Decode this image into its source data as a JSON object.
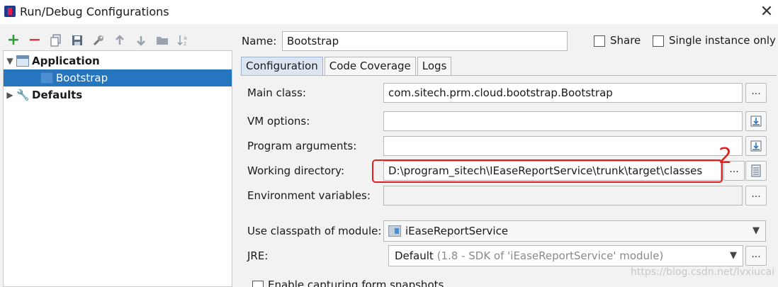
{
  "window": {
    "title": "Run/Debug Configurations",
    "close_glyph": "✕"
  },
  "toolbar": {
    "buttons": [
      {
        "name": "add-icon",
        "glyph": "+",
        "color": "#2e9e3a"
      },
      {
        "name": "remove-icon",
        "glyph": "−",
        "color": "#d43a3a"
      },
      {
        "name": "copy-icon",
        "glyph": "⧉",
        "color": "#5a6b7d"
      },
      {
        "name": "save-icon",
        "glyph": "💾",
        "color": "#5a6b7d"
      },
      {
        "name": "edit-defaults-icon",
        "glyph": "🔧",
        "color": "#777777"
      },
      {
        "name": "move-up-icon",
        "glyph": "↑",
        "color": "#9aa3ad"
      },
      {
        "name": "move-down-icon",
        "glyph": "↓",
        "color": "#9aa3ad"
      },
      {
        "name": "folder-icon",
        "glyph": "▬",
        "color": "#9aa3ad"
      },
      {
        "name": "sort-icon",
        "glyph": "↓a",
        "color": "#9aa3ad"
      }
    ]
  },
  "tree": {
    "items": [
      {
        "label": "Application",
        "expanded": true
      },
      {
        "label": "Bootstrap",
        "selected": true
      },
      {
        "label": "Defaults",
        "expanded": false
      }
    ]
  },
  "form": {
    "name_label": "Name:",
    "name_value": "Bootstrap",
    "share_label": "Share",
    "single_instance_label": "Single instance only",
    "tabs": [
      "Configuration",
      "Code Coverage",
      "Logs"
    ],
    "main_class_label": "Main class:",
    "main_class_value": "com.sitech.prm.cloud.bootstrap.Bootstrap",
    "vm_options_label": "VM options:",
    "program_arguments_label": "Program arguments:",
    "working_directory_label": "Working directory:",
    "working_directory_value": "D:\\program_sitech\\IEaseReportService\\trunk\\target\\classes",
    "env_vars_label": "Environment variables:",
    "classpath_label": "Use classpath of module:",
    "classpath_value": "iEaseReportService",
    "jre_label": "JRE:",
    "jre_value": "Default",
    "jre_detail": "(1.8 - SDK of 'iEaseReportService' module)",
    "snapshot_label": "Enable capturing form snapshots",
    "browse_glyph": "..."
  },
  "annotation": {
    "number": "2",
    "color": "#e02020"
  },
  "watermark": "https://blog.csdn.net/lvxiucai"
}
